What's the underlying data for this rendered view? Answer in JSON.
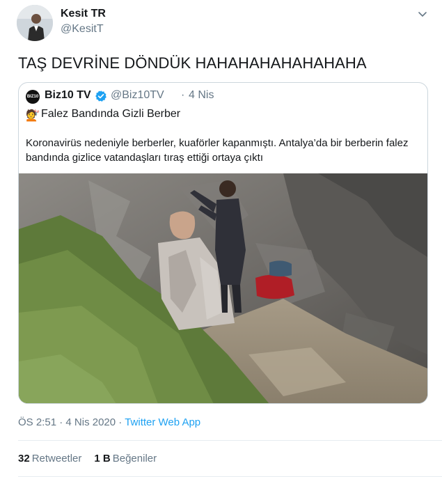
{
  "author": {
    "name": "Kesit TR",
    "handle": "@KesitT"
  },
  "tweet_text": "TAŞ DEVRİNE DÖNDÜK HAHAHAHAHAHAHAHA",
  "quoted": {
    "logo_text": "BIZ10",
    "name": "Biz10 TV",
    "handle": "@Biz10TV",
    "separator": "·",
    "date": "4 Nis",
    "title_icon": "💇",
    "title": "Falez Bandında Gizli Berber",
    "body": "Koronavirüs nedeniyle berberler, kuaförler kapanmıştı. Antalya’da bir berberin falez bandında gizlice vatandaşları tıraş ettiği ortaya çıktı"
  },
  "meta": {
    "time": "ÖS 2:51",
    "sep1": "·",
    "date": "4 Nis 2020",
    "sep2": "·",
    "source": "Twitter Web App"
  },
  "stats": {
    "retweets_count": "32",
    "retweets_label": "Retweetler",
    "likes_count": "1 B",
    "likes_label": "Beğeniler"
  },
  "colors": {
    "link": "#1da1f2",
    "secondary_text": "#657786",
    "border": "#ccd6dd"
  },
  "icons": {
    "menu": "chevron-down-icon",
    "verified": "verified-badge-icon"
  }
}
